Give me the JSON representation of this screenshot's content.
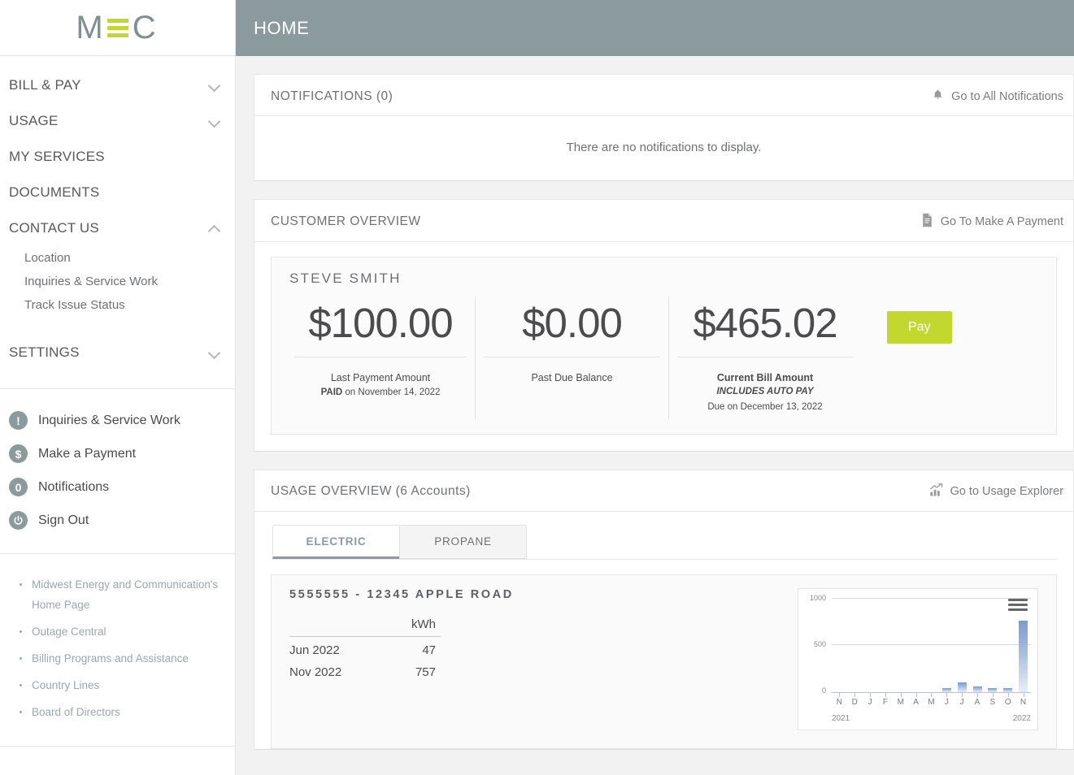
{
  "brand": {
    "logo_m": "M",
    "logo_c": "C",
    "accent_green": "#c3d82f",
    "accent_gray": "#8b9a9c"
  },
  "topbar": {
    "title": "HOME"
  },
  "sidebar": {
    "nav": [
      {
        "label": "BILL & PAY",
        "chevron": "chevron-down-icon",
        "expanded": false
      },
      {
        "label": "USAGE",
        "chevron": "chevron-down-icon",
        "expanded": false
      },
      {
        "label": "MY SERVICES",
        "chevron": "",
        "expanded": false
      },
      {
        "label": "DOCUMENTS",
        "chevron": "",
        "expanded": false
      },
      {
        "label": "CONTACT US",
        "chevron": "chevron-up-icon",
        "expanded": true
      },
      {
        "label": "SETTINGS",
        "chevron": "chevron-down-icon",
        "expanded": false
      }
    ],
    "contact_sub": [
      {
        "label": "Location"
      },
      {
        "label": "Inquiries & Service Work"
      },
      {
        "label": "Track Issue Status"
      }
    ],
    "quick_links": [
      {
        "label": "Inquiries & Service Work",
        "icon": "exclamation-circle-icon",
        "glyph": "!"
      },
      {
        "label": "Make a Payment",
        "icon": "dollar-circle-icon",
        "glyph": "$"
      },
      {
        "label": "Notifications",
        "icon": "notification-count-icon",
        "glyph": "0"
      },
      {
        "label": "Sign Out",
        "icon": "power-icon",
        "glyph": "⏻"
      }
    ],
    "footer_links": [
      "Midwest Energy and Communication's Home Page",
      "Outage Central",
      "Billing Programs and Assistance",
      "Country Lines",
      "Board of Directors"
    ]
  },
  "notifications": {
    "title": "NOTIFICATIONS (0)",
    "action_label": "Go to All Notifications",
    "action_icon": "bell-icon",
    "empty_message": "There are no notifications to display."
  },
  "customer_overview": {
    "title": "CUSTOMER OVERVIEW",
    "action_label": "Go To Make A Payment",
    "action_icon": "invoice-document-icon",
    "customer_name": "STEVE SMITH",
    "stats": [
      {
        "amount": "$100.00",
        "label": "Last Payment Amount",
        "sub_bold": "PAID",
        "sub_rest": " on November 14, 2022"
      },
      {
        "amount": "$0.00",
        "label": "Past Due Balance",
        "sub_bold": "",
        "sub_rest": ""
      },
      {
        "amount": "$465.02",
        "label": "Current Bill Amount",
        "italic": "INCLUDES AUTO PAY",
        "sub_rest": "Due on December 13, 2022"
      }
    ],
    "pay_button": "Pay"
  },
  "usage_overview": {
    "title": "USAGE OVERVIEW (6 Accounts)",
    "action_label": "Go to Usage Explorer",
    "action_icon": "bar-chart-arrow-icon",
    "tabs": [
      {
        "label": "ELECTRIC",
        "active": true
      },
      {
        "label": "PROPANE",
        "active": false
      }
    ],
    "account": {
      "id_line": "5555555 - 12345 APPLE  ROAD",
      "unit_header": "kWh",
      "rows": [
        {
          "period": "Jun 2022",
          "value": "47"
        },
        {
          "period": "Nov 2022",
          "value": "757"
        }
      ]
    }
  },
  "chart_data": {
    "type": "bar",
    "title": "",
    "xlabel": "",
    "ylabel": "",
    "ylim": [
      0,
      1000
    ],
    "yticks": [
      0,
      500,
      1000
    ],
    "grid": true,
    "legend": "none",
    "year_labels": [
      "2021",
      "2022"
    ],
    "categories": [
      "N",
      "D",
      "J",
      "F",
      "M",
      "A",
      "M",
      "J",
      "J",
      "A",
      "S",
      "O",
      "N"
    ],
    "values": [
      0,
      0,
      0,
      0,
      0,
      0,
      0,
      47,
      100,
      62,
      45,
      44,
      757
    ],
    "bar_color": "#7b9ad1",
    "menu_icon": "hamburger-menu-icon"
  }
}
